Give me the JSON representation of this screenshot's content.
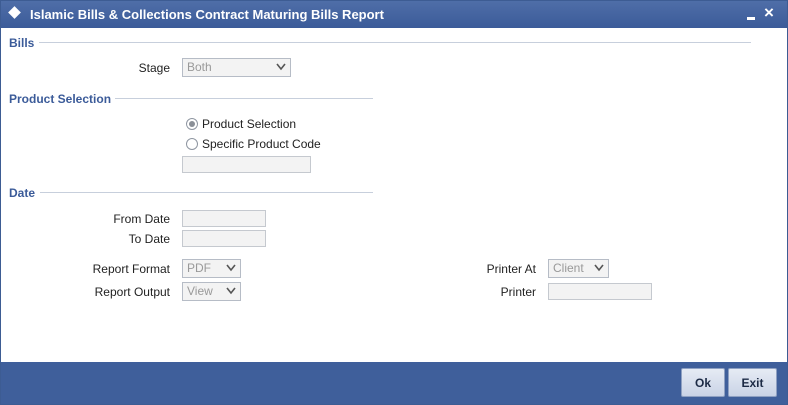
{
  "window": {
    "title": "Islamic Bills & Collections Contract Maturing Bills Report"
  },
  "sections": {
    "bills": "Bills",
    "product_selection": "Product Selection",
    "date": "Date"
  },
  "fields": {
    "stage": {
      "label": "Stage",
      "value": "Both"
    },
    "product_selection_option": "Product Selection",
    "specific_product_code_option": "Specific Product Code",
    "product_code_value": "",
    "from_date": {
      "label": "From Date",
      "value": ""
    },
    "to_date": {
      "label": "To Date",
      "value": ""
    },
    "report_format": {
      "label": "Report Format",
      "value": "PDF"
    },
    "report_output": {
      "label": "Report Output",
      "value": "View"
    },
    "printer_at": {
      "label": "Printer At",
      "value": "Client"
    },
    "printer": {
      "label": "Printer",
      "value": ""
    }
  },
  "buttons": {
    "ok": "Ok",
    "exit": "Exit"
  },
  "icons": {
    "title": "diamond-icon",
    "minimize": "minimize-icon",
    "close": "close-icon",
    "dropdown": "chevron-down-icon"
  }
}
